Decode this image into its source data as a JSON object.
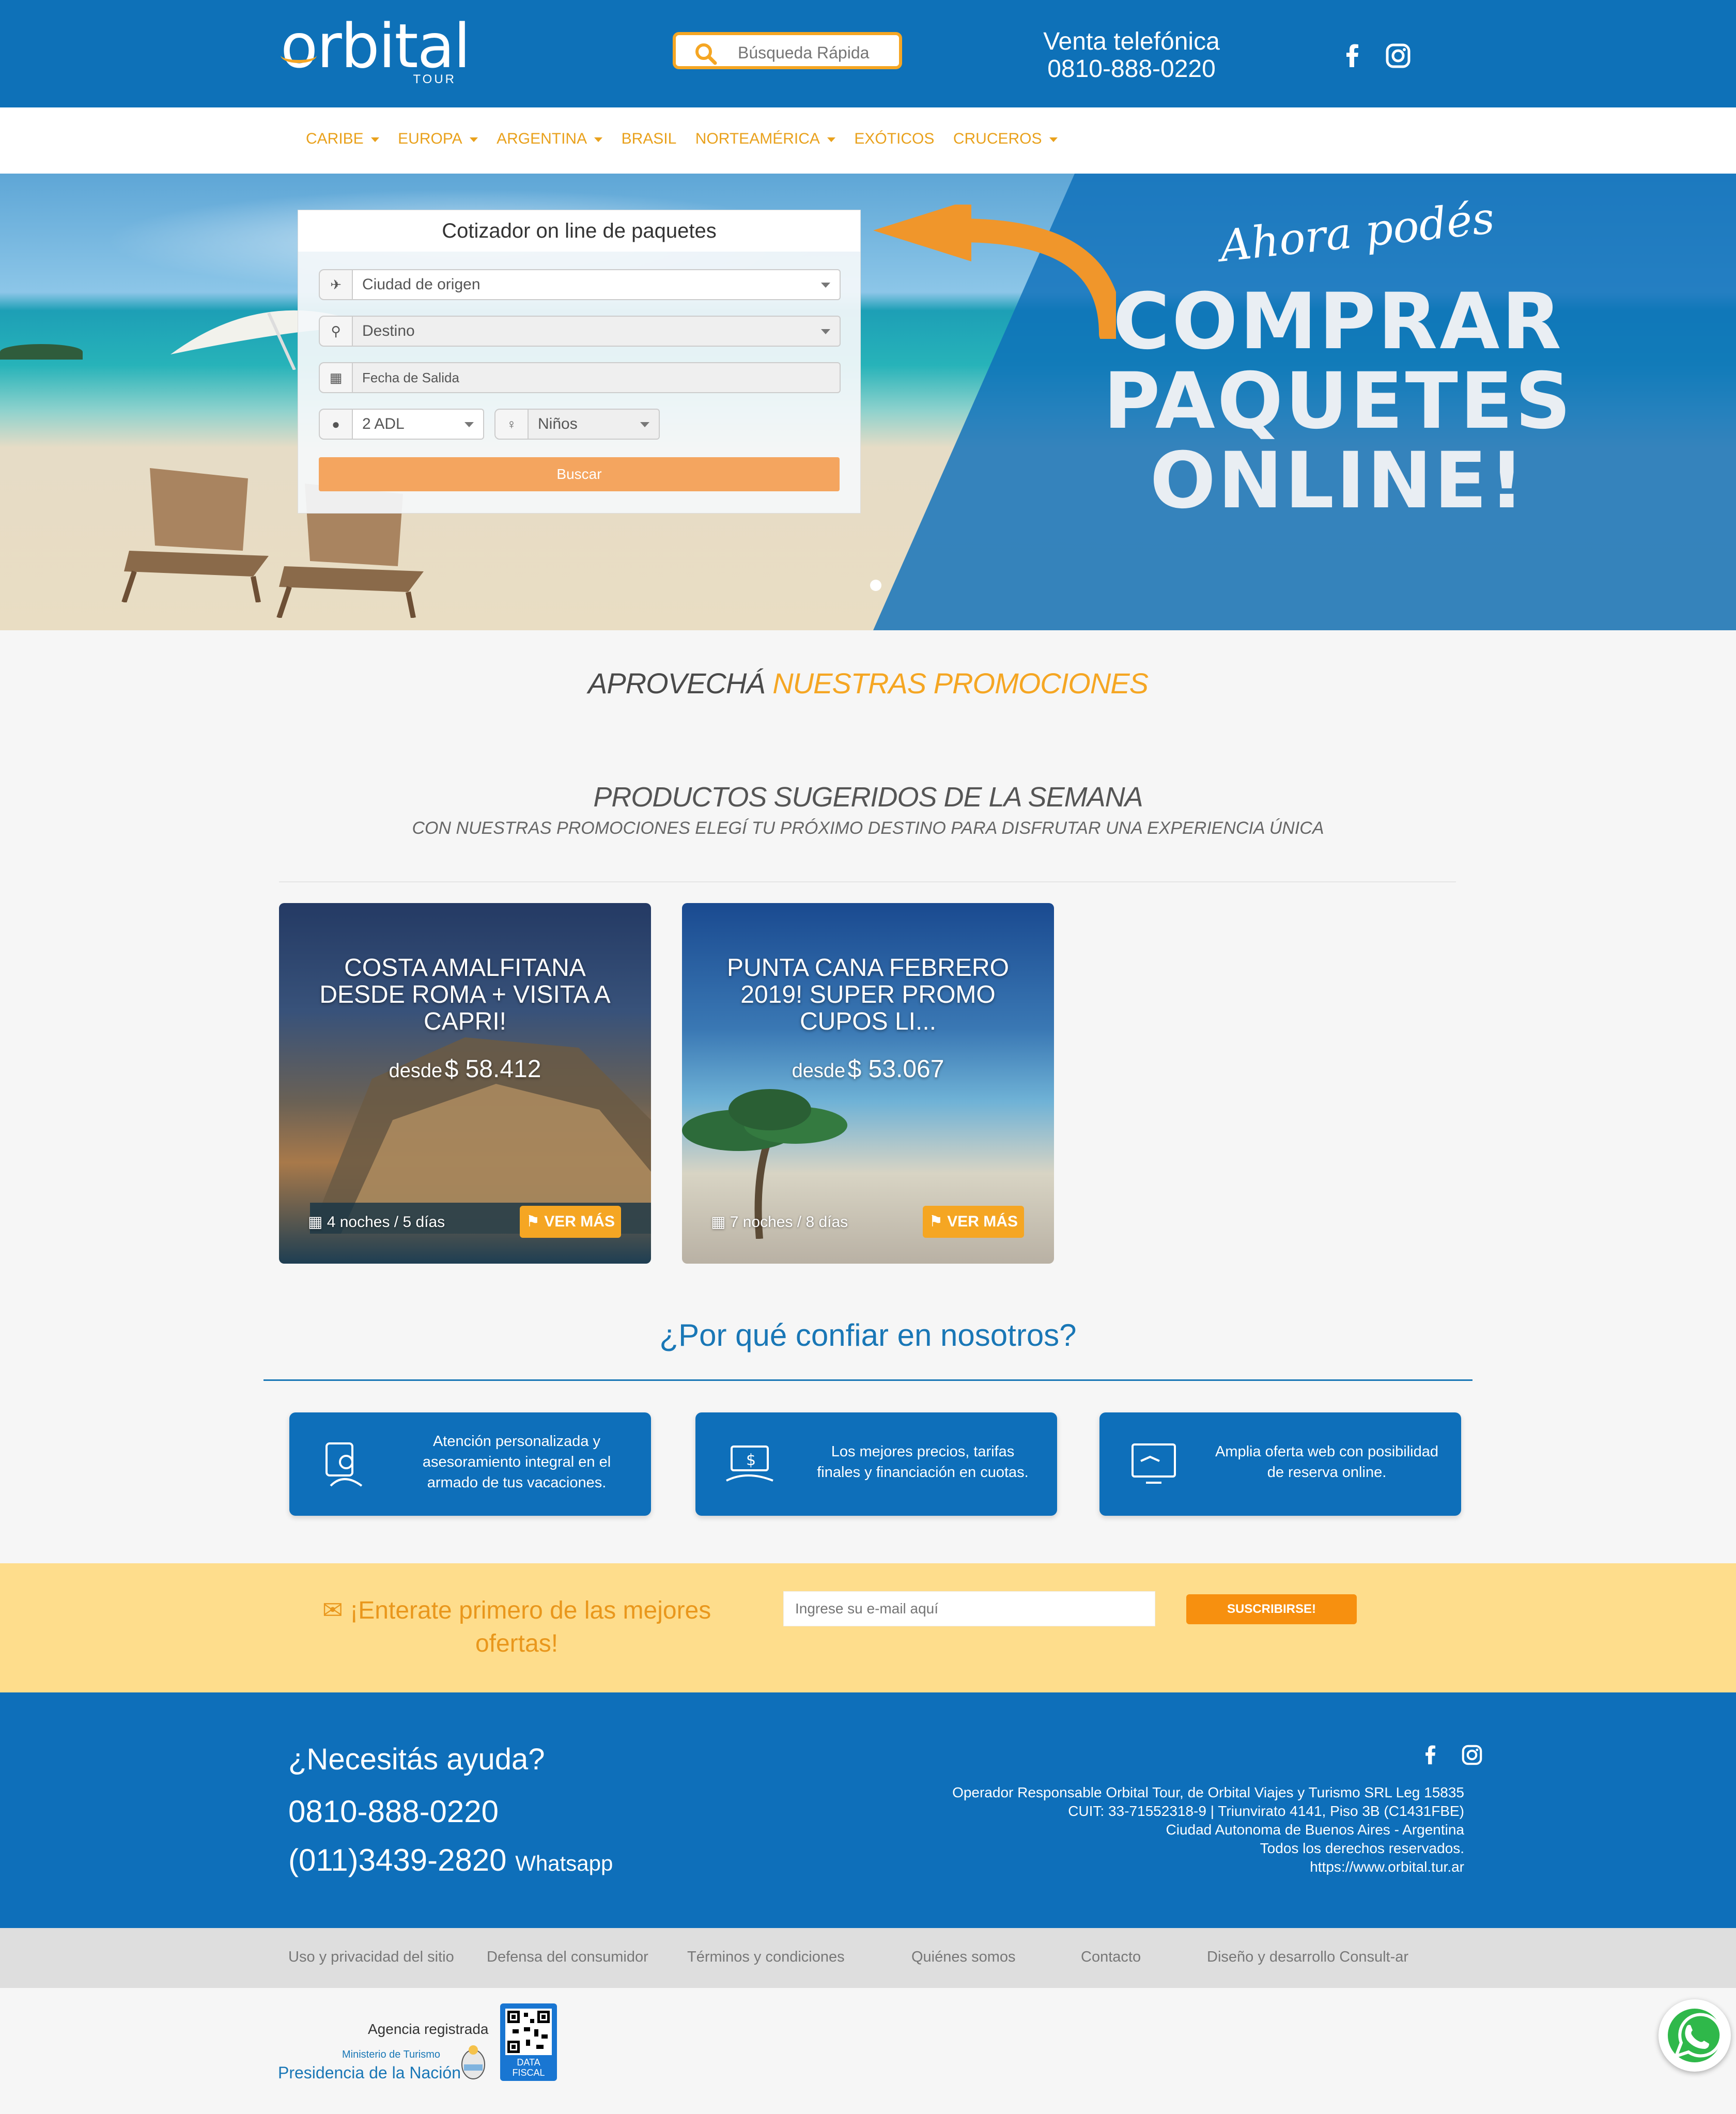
{
  "header": {
    "logo_text": "orbital",
    "logo_sub": "TOUR",
    "search_placeholder": "Búsqueda Rápida",
    "phone_label": "Venta telefónica",
    "phone_number": "0810-888-0220",
    "social_icons": [
      "facebook-icon",
      "instagram-icon"
    ],
    "colors": {
      "primary": "#0e71b8",
      "accent": "#f5a623"
    }
  },
  "nav": {
    "items": [
      {
        "label": "CARIBE",
        "dropdown": true
      },
      {
        "label": "EUROPA",
        "dropdown": true
      },
      {
        "label": "ARGENTINA",
        "dropdown": true
      },
      {
        "label": "BRASIL",
        "dropdown": false
      },
      {
        "label": "NORTEAMÉRICA",
        "dropdown": true
      },
      {
        "label": "EXÓTICOS",
        "dropdown": false
      },
      {
        "label": "CRUCEROS",
        "dropdown": true
      }
    ]
  },
  "hero": {
    "tagline_small": "Ahora podés",
    "tagline_lines": [
      "COMPRAR",
      "PAQUETES",
      "ONLINE!"
    ],
    "quoter": {
      "title": "Cotizador on line de paquetes",
      "origin_placeholder": "Ciudad de origen",
      "destination_placeholder": "Destino",
      "date_placeholder": "Fecha de Salida",
      "adults_value": "2 ADL",
      "children_value": "Niños",
      "search_label": "Buscar"
    }
  },
  "promos": {
    "heading_plain": "APROVECHÁ",
    "heading_accent": "NUESTRAS PROMOCIONES",
    "suggested_title": "PRODUCTOS SUGERIDOS DE LA SEMANA",
    "suggested_subtitle": "CON NUESTRAS PROMOCIONES ELEGÍ TU PRÓXIMO DESTINO PARA DISFRUTAR UNA EXPERIENCIA ÚNICA",
    "cards": [
      {
        "title": "COSTA AMALFITANA DESDE ROMA + VISITA A CAPRI!",
        "desde": "desde",
        "price": "$ 58.412",
        "duration": "4 noches / 5 días",
        "button": "VER MÁS"
      },
      {
        "title": "PUNTA CANA FEBRERO 2019! SUPER PROMO CUPOS LI...",
        "desde": "desde",
        "price": "$ 53.067",
        "duration": "7 noches / 8 días",
        "button": "VER MÁS"
      }
    ]
  },
  "why": {
    "title": "¿Por qué confiar en nosotros?",
    "items": [
      {
        "icon": "advisor-icon",
        "text": "Atención personalizada y asesoramiento integral en el armado de tus vacaciones."
      },
      {
        "icon": "price-icon",
        "text": "Los mejores precios, tarifas finales y financiación en cuotas."
      },
      {
        "icon": "web-booking-icon",
        "text": "Amplia oferta web con posibilidad de reserva online."
      }
    ]
  },
  "newsletter": {
    "title": "¡Enterate primero de las mejores ofertas!",
    "email_placeholder": "Ingrese su e-mail aquí",
    "button": "SUSCRIBIRSE!"
  },
  "footer": {
    "help_title": "¿Necesitás ayuda?",
    "phone": "0810-888-0220",
    "whatsapp_number": "(011)3439-2820",
    "whatsapp_label": "Whatsapp",
    "legal": [
      "Operador Responsable Orbital Tour, de Orbital Viajes y Turismo SRL Leg 15835",
      "CUIT: 33-71552318-9 | Triunvirato 4141, Piso 3B (C1431FBE)",
      "Ciudad Autonoma de Buenos Aires - Argentina",
      "Todos los derechos reservados.",
      "https://www.orbital.tur.ar"
    ],
    "links": [
      "Uso y privacidad del sitio",
      "Defensa del consumidor",
      "Términos y condiciones",
      "Quiénes somos",
      "Contacto",
      "Diseño y desarrollo Consult-ar"
    ],
    "agency_registered": "Agencia registrada",
    "ministry": "Ministerio de Turismo",
    "presidency": "Presidencia de la Nación",
    "datafiscal": [
      "DATA",
      "FISCAL"
    ]
  }
}
